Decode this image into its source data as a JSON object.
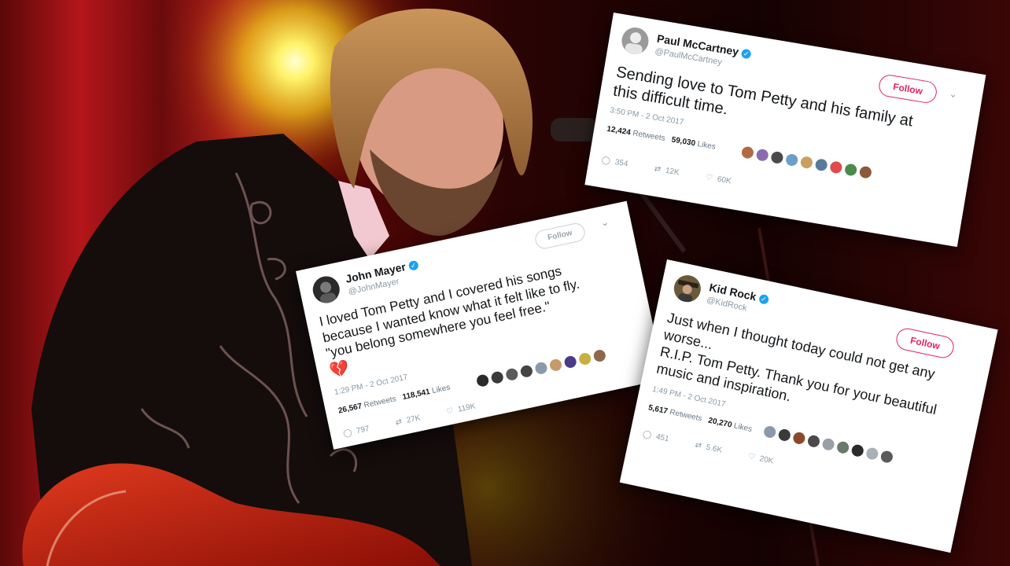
{
  "colors": {
    "twitter_blue": "#1da1f2",
    "follow_red": "#e0245e",
    "stage_red": "#7a0e0e"
  },
  "tweets": {
    "paul": {
      "name": "Paul McCartney",
      "handle": "@PaulMcCartney",
      "follow": "Follow",
      "line1": "Sending love to Tom Petty and his family at",
      "line2": "this difficult time.",
      "time": "3:50 PM - 2 Oct 2017",
      "retweets": "12,424",
      "retweets_label": "Retweets",
      "likes": "59,030",
      "likes_label": "Likes",
      "replies_count": "354",
      "retweet_count": "12K",
      "like_count": "60K"
    },
    "mayer": {
      "name": "John Mayer",
      "handle": "@JohnMayer",
      "follow": "Follow",
      "line1": "I loved Tom Petty and I covered his songs",
      "line2": "because I wanted know what it felt like to fly.",
      "line3": "\"you belong somewhere you feel free.\"",
      "time": "1:29 PM - 2 Oct 2017",
      "retweets": "26,567",
      "retweets_label": "Retweets",
      "likes": "118,541",
      "likes_label": "Likes",
      "replies_count": "797",
      "retweet_count": "27K",
      "like_count": "119K"
    },
    "kidrock": {
      "name": "Kid Rock",
      "handle": "@KidRock",
      "follow": "Follow",
      "line1": "Just when I thought today could not get any",
      "line2": "worse...",
      "line3": "R.I.P. Tom Petty. Thank you for your beautiful",
      "line4": "music and inspiration.",
      "time": "1:49 PM - 2 Oct 2017",
      "retweets": "5,617",
      "retweets_label": "Retweets",
      "likes": "20,270",
      "likes_label": "Likes",
      "replies_count": "451",
      "retweet_count": "5.6K",
      "like_count": "20K"
    }
  }
}
